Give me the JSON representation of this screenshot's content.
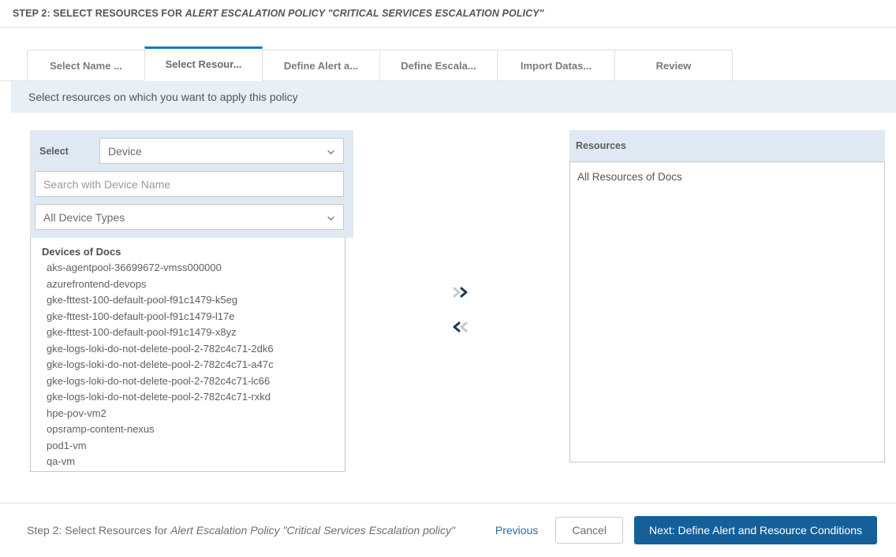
{
  "header": {
    "prefix": "STEP 2: SELECT RESOURCES FOR ",
    "policy": "ALERT ESCALATION POLICY \"CRITICAL SERVICES ESCALATION POLICY\""
  },
  "tabs": [
    {
      "label": "Select Name ...",
      "name": "tab-select-name",
      "active": false
    },
    {
      "label": "Select Resour...",
      "name": "tab-select-resources",
      "active": true
    },
    {
      "label": "Define Alert a...",
      "name": "tab-define-alert",
      "active": false
    },
    {
      "label": "Define Escala...",
      "name": "tab-define-escalation",
      "active": false
    },
    {
      "label": "Import Datas...",
      "name": "tab-import-dataset",
      "active": false
    },
    {
      "label": "Review",
      "name": "tab-review",
      "active": false
    }
  ],
  "banner": {
    "text": "Select resources on which you want to apply this policy"
  },
  "left_panel": {
    "select_label": "Select",
    "entity_select_value": "Device",
    "search_placeholder": "Search with Device Name",
    "search_value": "",
    "device_type_value": "All Device Types",
    "list_title": "Devices of Docs",
    "devices": [
      "aks-agentpool-36699672-vmss000000",
      "azurefrontend-devops",
      "gke-fttest-100-default-pool-f91c1479-k5eg",
      "gke-fttest-100-default-pool-f91c1479-l17e",
      "gke-fttest-100-default-pool-f91c1479-x8yz",
      "gke-logs-loki-do-not-delete-pool-2-782c4c71-2dk6",
      "gke-logs-loki-do-not-delete-pool-2-782c4c71-a47c",
      "gke-logs-loki-do-not-delete-pool-2-782c4c71-lc66",
      "gke-logs-loki-do-not-delete-pool-2-782c4c71-rxkd",
      "hpe-pov-vm2",
      "opsramp-content-nexus",
      "pod1-vm",
      "qa-vm"
    ]
  },
  "transfer": {
    "add_icon": "chevron-double-right-icon",
    "remove_icon": "chevron-double-left-icon"
  },
  "right_panel": {
    "title": "Resources",
    "items": [
      "All Resources of Docs"
    ]
  },
  "footer": {
    "text_prefix": "Step 2: Select Resources for ",
    "text_policy": "Alert Escalation Policy \"Critical Services Escalation policy\"",
    "previous_label": "Previous",
    "cancel_label": "Cancel",
    "next_label": "Next: Define Alert and Resource Conditions"
  },
  "colors": {
    "accent_blue": "#0e79c4",
    "primary_button": "#15609b",
    "panel_blue": "#dee9f3",
    "banner_blue": "#e8eff7"
  }
}
